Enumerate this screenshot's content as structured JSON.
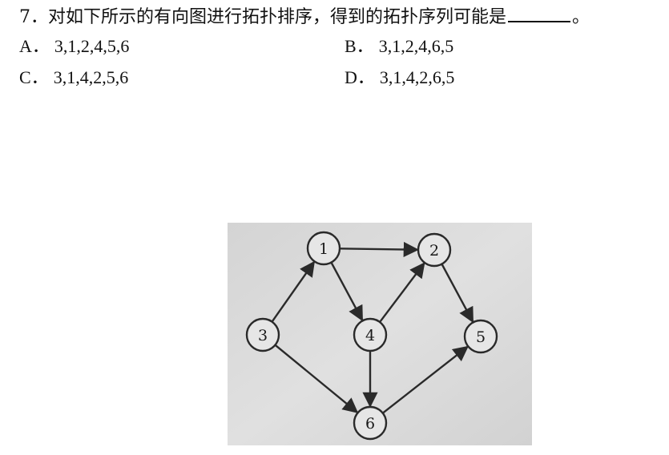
{
  "question": {
    "number": "7．",
    "text": "对如下所示的有向图进行拓扑排序，得到的拓扑序列可能是",
    "end": "。"
  },
  "options": [
    {
      "letter": "A．",
      "value": "3,1,2,4,5,6"
    },
    {
      "letter": "B．",
      "value": "3,1,2,4,6,5"
    },
    {
      "letter": "C．",
      "value": "3,1,4,2,5,6"
    },
    {
      "letter": "D．",
      "value": "3,1,4,2,6,5"
    }
  ],
  "graph": {
    "nodes": [
      "1",
      "2",
      "3",
      "4",
      "5",
      "6"
    ],
    "edges": [
      [
        "3",
        "1"
      ],
      [
        "3",
        "6"
      ],
      [
        "1",
        "2"
      ],
      [
        "1",
        "4"
      ],
      [
        "4",
        "2"
      ],
      [
        "4",
        "6"
      ],
      [
        "2",
        "5"
      ],
      [
        "6",
        "5"
      ]
    ]
  }
}
